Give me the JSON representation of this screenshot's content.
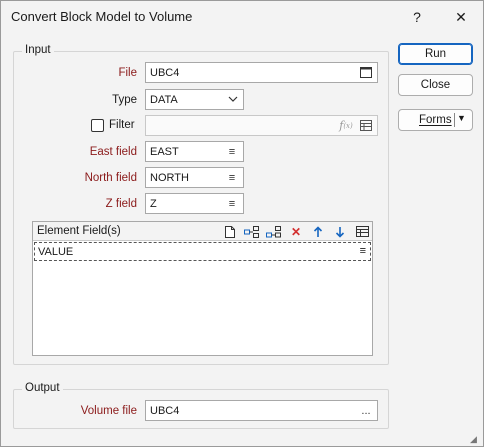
{
  "window": {
    "title": "Convert Block Model to Volume",
    "help_glyph": "?",
    "close_glyph": "✕"
  },
  "input_group": {
    "label": "Input",
    "file": {
      "label": "File",
      "value": "UBC4"
    },
    "type": {
      "label": "Type",
      "value": "DATA"
    },
    "filter": {
      "label": "Filter",
      "value": "",
      "checked": false
    },
    "east_field": {
      "label": "East field",
      "value": "EAST"
    },
    "north_field": {
      "label": "North field",
      "value": "NORTH"
    },
    "z_field": {
      "label": "Z field",
      "value": "Z"
    },
    "element_fields": {
      "header": "Element Field(s)",
      "rows": [
        "VALUE"
      ]
    }
  },
  "output_group": {
    "label": "Output",
    "volume_file": {
      "label": "Volume file",
      "value": "UBC4",
      "browse_glyph": "..."
    }
  },
  "buttons": {
    "run": "Run",
    "close": "Close",
    "forms": "Forms"
  },
  "colors": {
    "required_label": "#8b1a1a",
    "accent": "#1565c0",
    "delete_icon": "#d32f2f",
    "arrow_icon": "#1565c0"
  }
}
